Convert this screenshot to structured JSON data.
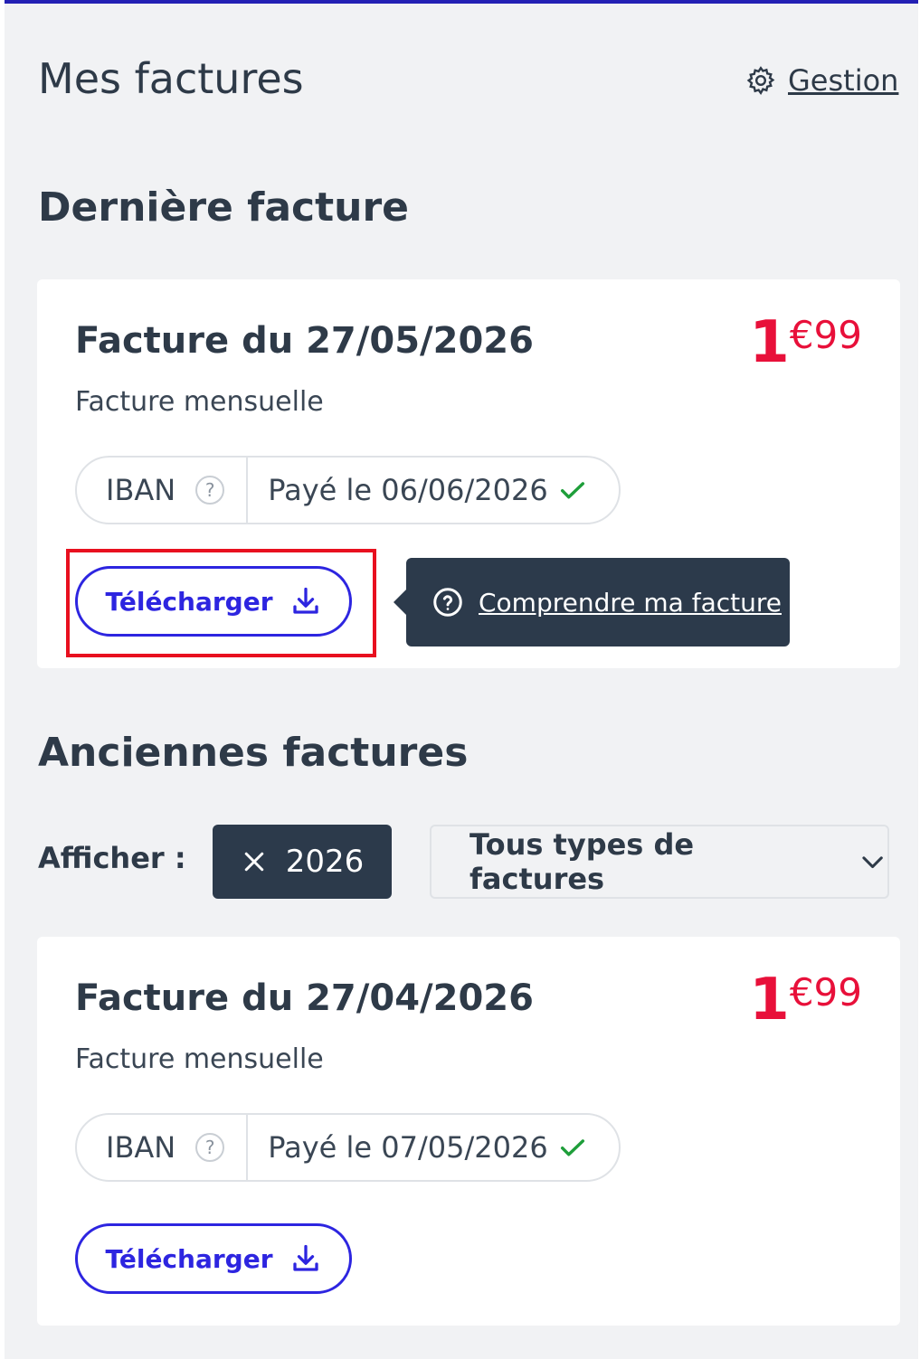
{
  "header": {
    "title": "Mes factures",
    "gestion_label": "Gestion"
  },
  "latest": {
    "section_title": "Dernière facture",
    "invoice": {
      "title": "Facture du 27/05/2026",
      "type": "Facture mensuelle",
      "amount_int": "1",
      "amount_dec": "€99",
      "method": "IBAN",
      "help": "?",
      "status": "Payé le 06/06/2026",
      "download_label": "Télécharger"
    },
    "tooltip_label": "Comprendre ma facture"
  },
  "older": {
    "section_title": "Anciennes factures",
    "filter_label": "Afficher :",
    "year_chip": "2026",
    "type_select": "Tous types de factures",
    "invoice": {
      "title": "Facture du 27/04/2026",
      "type": "Facture mensuelle",
      "amount_int": "1",
      "amount_dec": "€99",
      "method": "IBAN",
      "help": "?",
      "status": "Payé le 07/05/2026",
      "download_label": "Télécharger"
    }
  },
  "colors": {
    "accent": "#2d25e0",
    "amount": "#e8103a",
    "paid_check": "#1e9e3a",
    "dark": "#2c3a4b",
    "highlight": "#e8101f"
  }
}
